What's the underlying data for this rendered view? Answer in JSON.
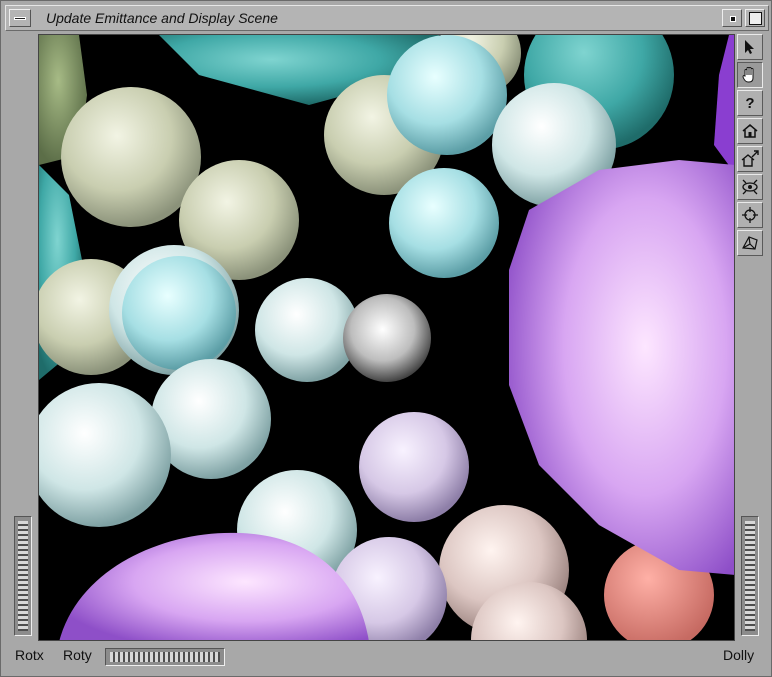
{
  "window": {
    "title": "Update Emittance and Display Scene"
  },
  "toolbar": {
    "tools": [
      {
        "name": "select-arrow-icon"
      },
      {
        "name": "hand-icon",
        "pressed": true
      },
      {
        "name": "help-icon",
        "glyph": "?"
      },
      {
        "name": "home-icon"
      },
      {
        "name": "set-home-icon"
      },
      {
        "name": "view-all-icon"
      },
      {
        "name": "seek-icon"
      },
      {
        "name": "perspective-icon"
      }
    ]
  },
  "thumbwheels": {
    "rotx_label": "Rotx",
    "roty_label": "Roty",
    "dolly_label": "Dolly"
  }
}
